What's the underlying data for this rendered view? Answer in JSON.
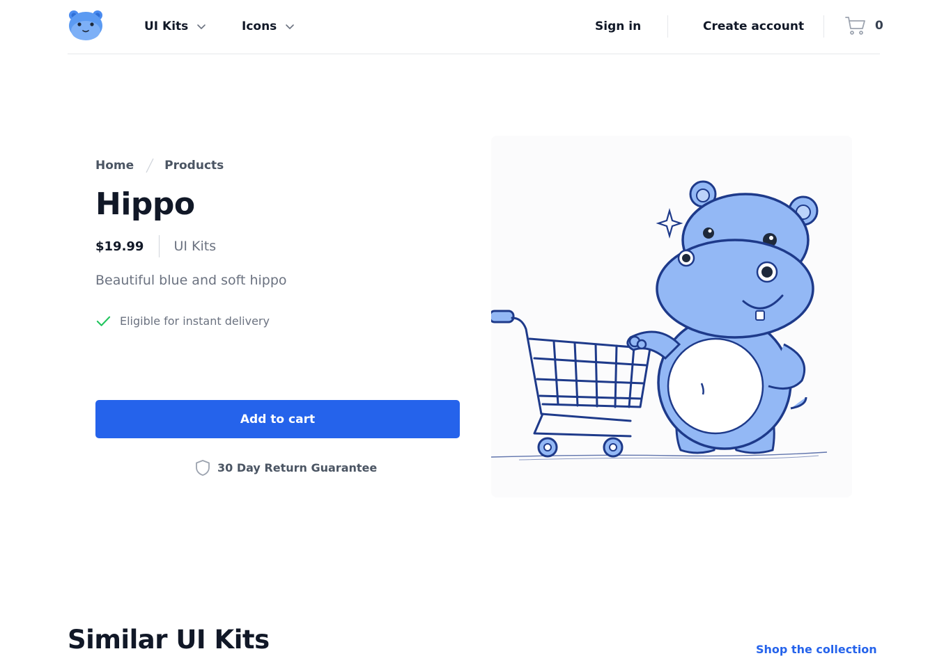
{
  "header": {
    "logo": "hippo-logo",
    "nav": [
      {
        "label": "UI Kits",
        "icon": "chevron-down-icon"
      },
      {
        "label": "Icons",
        "icon": "chevron-down-icon"
      }
    ],
    "sign_in": "Sign in",
    "create_account": "Create account",
    "cart_count": "0",
    "cart_icon": "shopping-cart-icon"
  },
  "breadcrumb": [
    "Home",
    "Products"
  ],
  "product": {
    "name": "Hippo",
    "price": "$19.99",
    "category": "UI Kits",
    "description": "Beautiful blue and soft hippo",
    "delivery_note": "Eligible for instant delivery",
    "add_to_cart": "Add to cart",
    "guarantee": "30 Day Return Guarantee",
    "image": "hippo-pushing-shopping-cart-illustration"
  },
  "similar": {
    "title": "Similar UI Kits",
    "shop_link": "Shop the collection"
  },
  "colors": {
    "primary": "#2563eb",
    "check": "#22c55e",
    "hippo": "#93b8f5",
    "outline": "#1e3a8a"
  }
}
